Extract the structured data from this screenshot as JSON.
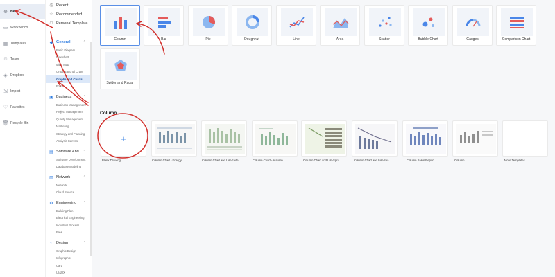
{
  "leftnav": {
    "items": [
      {
        "label": "New",
        "icon": "plus-icon",
        "active": true
      },
      {
        "label": "Workbench",
        "icon": "monitor-icon"
      },
      {
        "label": "Templates",
        "icon": "grid-icon"
      },
      {
        "label": "Team",
        "icon": "people-icon"
      },
      {
        "label": "Dropbox",
        "icon": "dropbox-icon"
      },
      {
        "label": "Import",
        "icon": "import-icon"
      },
      {
        "label": "Favorites",
        "icon": "heart-icon"
      },
      {
        "label": "Recycle Bin",
        "icon": "trash-icon"
      }
    ]
  },
  "categories": {
    "top": [
      {
        "label": "Recent",
        "icon": "clock-icon"
      },
      {
        "label": "Recommended",
        "icon": "star-icon"
      },
      {
        "label": "Personal Template",
        "icon": "person-icon"
      }
    ],
    "groups": [
      {
        "label": "General",
        "open": true,
        "subs": [
          "Basic Diagram",
          "Flowchart",
          "Mind Map",
          "Organizational Chart",
          "Graphs and Charts",
          "Form"
        ]
      },
      {
        "label": "Business",
        "open": true,
        "subs": [
          "Business Management",
          "Project Management",
          "Quality Management",
          "Marketing",
          "Strategy and Planning",
          "Analysis Canvas"
        ]
      },
      {
        "label": "Software And...",
        "open": true,
        "subs": [
          "Software Development",
          "Database Modeling"
        ]
      },
      {
        "label": "Network",
        "open": true,
        "subs": [
          "Network",
          "Cloud Service"
        ]
      },
      {
        "label": "Engineering",
        "open": true,
        "subs": [
          "Building Plan",
          "Electrical Engineering",
          "Industrial Process",
          "Files"
        ]
      },
      {
        "label": "Design",
        "open": true,
        "subs": [
          "Graphic Design",
          "Infographic",
          "Card",
          "UI&UX"
        ]
      }
    ],
    "active_sub": "Graphs and Charts"
  },
  "chart_types": [
    {
      "label": "Column",
      "icon": "column-chart-icon",
      "selected": true
    },
    {
      "label": "Bar",
      "icon": "bar-chart-icon"
    },
    {
      "label": "Pie",
      "icon": "pie-chart-icon"
    },
    {
      "label": "Doughnut",
      "icon": "doughnut-chart-icon"
    },
    {
      "label": "Line",
      "icon": "line-chart-icon"
    },
    {
      "label": "Area",
      "icon": "area-chart-icon"
    },
    {
      "label": "Scatter",
      "icon": "scatter-chart-icon"
    },
    {
      "label": "Bubble Chart",
      "icon": "bubble-chart-icon"
    },
    {
      "label": "Gauges",
      "icon": "gauge-icon"
    },
    {
      "label": "Comparison Chart",
      "icon": "comparison-chart-icon"
    },
    {
      "label": "Spider and Radar",
      "icon": "radar-chart-icon"
    }
  ],
  "section": {
    "title": "Column"
  },
  "templates": [
    {
      "caption": "Blank Drawing"
    },
    {
      "caption": "Column Chart - Energy"
    },
    {
      "caption": "Column Chart and List-Fade"
    },
    {
      "caption": "Column Chart - Autumn"
    },
    {
      "caption": "Column Chart and List-Spri..."
    },
    {
      "caption": "Column Chart and List-Sea"
    },
    {
      "caption": "Column Sales Report"
    },
    {
      "caption": "Column"
    },
    {
      "caption": "More Templates"
    }
  ],
  "colors": {
    "accent": "#2f7ce0",
    "annotation": "#d2302c"
  }
}
